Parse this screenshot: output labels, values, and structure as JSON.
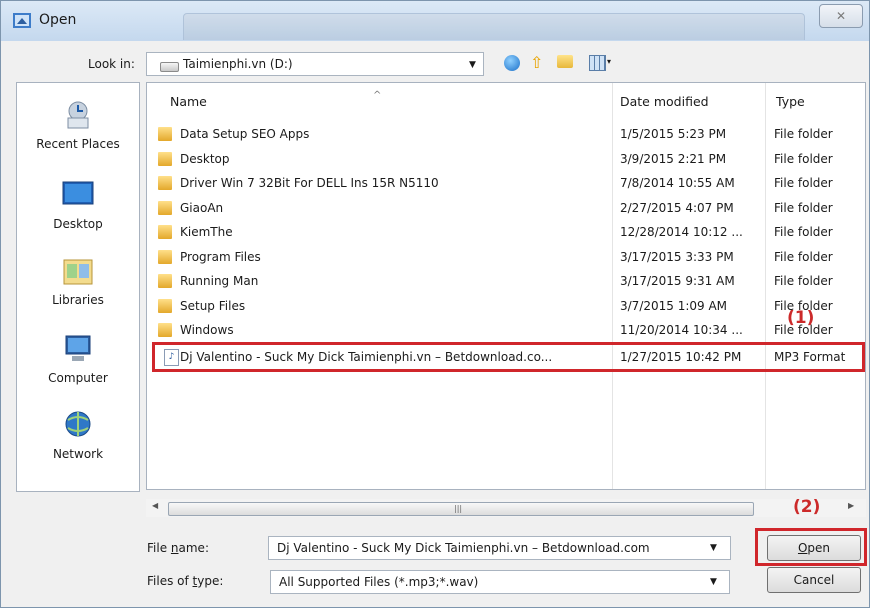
{
  "window": {
    "title": "Open",
    "close_glyph": "✕"
  },
  "toolbar": {
    "look_in_label": "Look in:",
    "look_in_value": "Taimienphi.vn (D:)",
    "dropdown_glyph": "▼",
    "up_glyph": "⇧",
    "views_arrow_glyph": "▾"
  },
  "places": [
    {
      "label": "Recent Places",
      "icon": "recent-places-icon"
    },
    {
      "label": "Desktop",
      "icon": "desktop-icon"
    },
    {
      "label": "Libraries",
      "icon": "libraries-icon"
    },
    {
      "label": "Computer",
      "icon": "computer-icon"
    },
    {
      "label": "Network",
      "icon": "network-icon"
    }
  ],
  "columns": {
    "name": "Name",
    "date": "Date modified",
    "type": "Type",
    "sort_glyph": "^"
  },
  "files": [
    {
      "name": "Data Setup SEO Apps",
      "date": "1/5/2015 5:23 PM",
      "type": "File folder"
    },
    {
      "name": "Desktop",
      "date": "3/9/2015 2:21 PM",
      "type": "File folder"
    },
    {
      "name": "Driver Win 7 32Bit For DELL Ins 15R N5110",
      "date": "7/8/2014 10:55 AM",
      "type": "File folder"
    },
    {
      "name": "GiaoAn",
      "date": "2/27/2015 4:07 PM",
      "type": "File folder"
    },
    {
      "name": "KiemThe",
      "date": "12/28/2014 10:12 ...",
      "type": "File folder"
    },
    {
      "name": "Program Files",
      "date": "3/17/2015 3:33 PM",
      "type": "File folder"
    },
    {
      "name": "Running Man",
      "date": "3/17/2015 9:31 AM",
      "type": "File folder"
    },
    {
      "name": "Setup Files",
      "date": "3/7/2015 1:09 AM",
      "type": "File folder"
    },
    {
      "name": "Windows",
      "date": "11/20/2014 10:34 ...",
      "type": "File folder"
    },
    {
      "name": "Dj Valentino - Suck My Dick Taimienphi.vn – Betdownload.co...",
      "date": "1/27/2015 10:42 PM",
      "type": "MP3 Format"
    }
  ],
  "mp3_glyph": "♪",
  "annotations": {
    "callout_1": "(1)",
    "callout_2": "(2)"
  },
  "scrollbar": {
    "left_glyph": "◀",
    "right_glyph": "▶",
    "grip_glyph": "|||"
  },
  "form": {
    "file_name_label_pre": "File ",
    "file_name_label_u": "n",
    "file_name_label_post": "ame:",
    "file_name_value": "Dj Valentino - Suck My Dick Taimienphi.vn – Betdownload.com",
    "file_type_label_pre": "Files of ",
    "file_type_label_u": "t",
    "file_type_label_post": "ype:",
    "file_type_value": "All Supported Files (*.mp3;*.wav)",
    "open_u": "O",
    "open_rest": "pen",
    "cancel_label": "Cancel"
  }
}
